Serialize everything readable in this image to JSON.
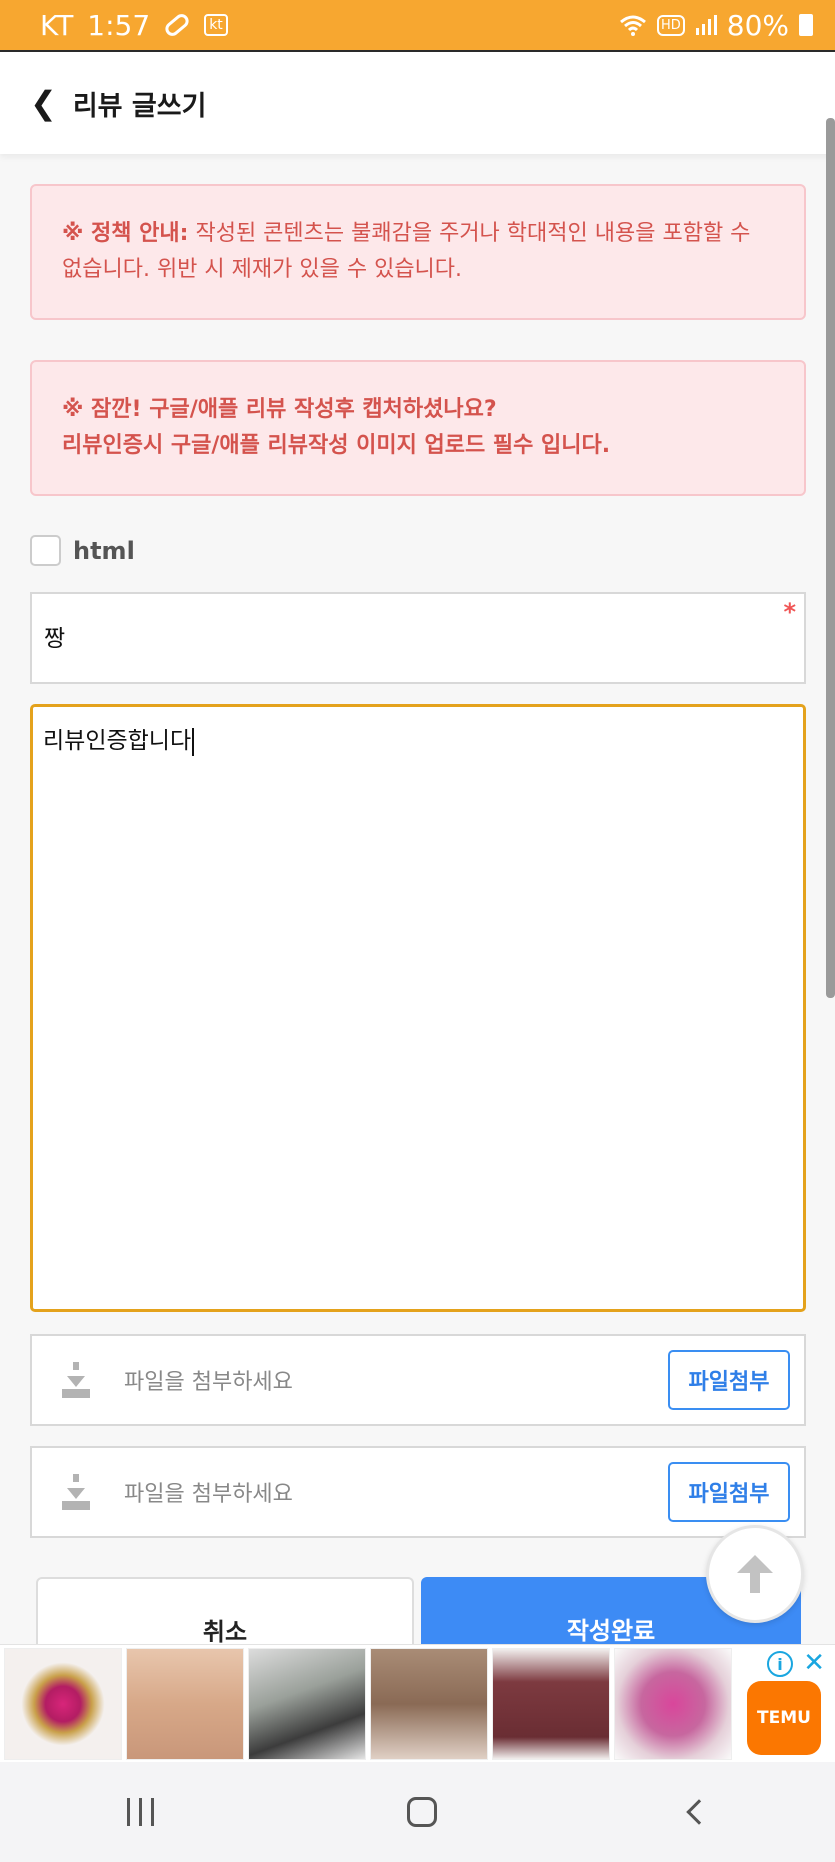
{
  "status_bar": {
    "carrier": "KT",
    "time": "1:57",
    "kt_badge": "kt",
    "hd_badge": "HD",
    "battery": "80%"
  },
  "header": {
    "title": "리뷰 글쓰기"
  },
  "notices": {
    "policy_label": "※ 정책 안내:",
    "policy_text": " 작성된 콘텐츠는 불쾌감을 주거나 학대적인 내용을 포함할 수 없습니다. 위반 시 제재가 있을 수 있습니다.",
    "capture_line1": "※ 잠깐! 구글/애플 리뷰 작성후 캡처하셨나요?",
    "capture_line2": "리뷰인증시 구글/애플 리뷰작성 이미지 업로드 필수 입니다."
  },
  "form": {
    "html_label": "html",
    "html_checked": false,
    "title_value": "짱",
    "required_mark": "*",
    "content_value": "리뷰인증합니다"
  },
  "files": [
    {
      "placeholder": "파일을 첨부하세요",
      "button_label": "파일첨부"
    },
    {
      "placeholder": "파일을 첨부하세요",
      "button_label": "파일첨부"
    }
  ],
  "actions": {
    "cancel_label": "취소",
    "submit_label": "작성완료"
  },
  "ad": {
    "info_icon": "i",
    "close_icon": "✕",
    "brand": "TEMU"
  },
  "colors": {
    "status_bar": "#f7a730",
    "notice_text": "#d4534d",
    "notice_bg": "#fde8ea",
    "focus_border": "#e4a21c",
    "primary": "#3d8bf5"
  }
}
